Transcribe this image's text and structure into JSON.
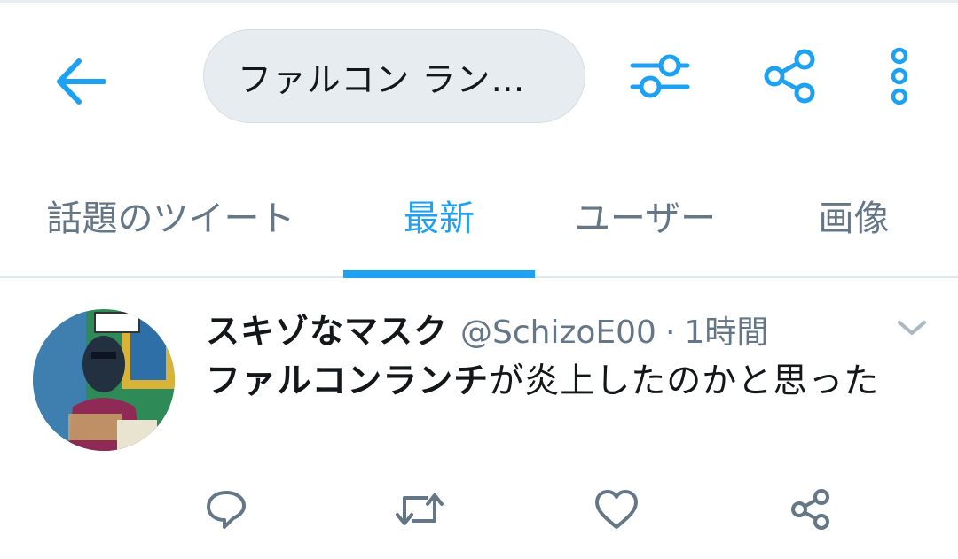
{
  "header": {
    "search_query": "ファルコン ラン…",
    "icons": {
      "back": "back-arrow-icon",
      "filter": "sliders-icon",
      "share": "share-icon",
      "more": "more-vertical-icon"
    }
  },
  "tabs": [
    {
      "label": "話題のツイート",
      "active": false
    },
    {
      "label": "最新",
      "active": true
    },
    {
      "label": "ユーザー",
      "active": false
    },
    {
      "label": "画像",
      "active": false
    }
  ],
  "tweet": {
    "display_name": "スキゾなマスク",
    "handle": "@SchizoE00",
    "separator": "·",
    "time": "1時間",
    "text_bold": "ファルコンランチ",
    "text_rest": "が炎上したのかと思った",
    "actions": [
      "reply-icon",
      "retweet-icon",
      "like-icon",
      "share-icon"
    ]
  },
  "colors": {
    "accent": "#1da1f2",
    "secondary_text": "#657786",
    "primary_text": "#14171a",
    "pill_bg": "#e6ecf0",
    "icon_gray": "#657786"
  }
}
